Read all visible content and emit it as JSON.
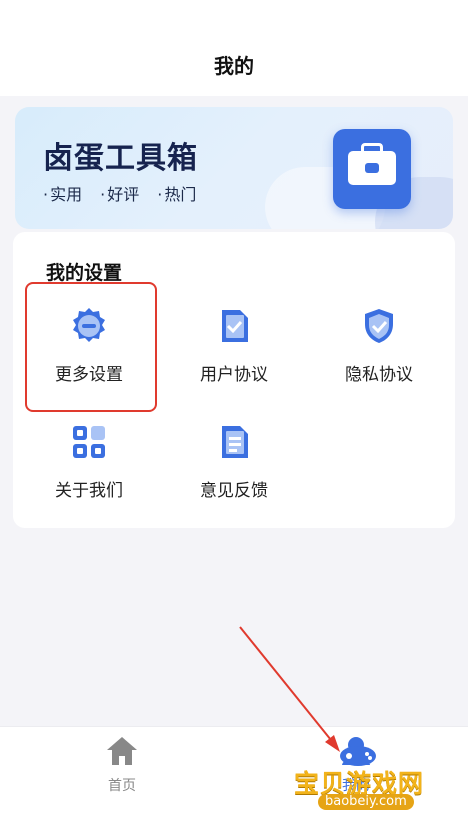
{
  "header": {
    "title": "我的"
  },
  "banner": {
    "title": "卤蛋工具箱",
    "tags": [
      "实用",
      "好评",
      "热门"
    ]
  },
  "settings": {
    "section_title": "我的设置",
    "items": [
      {
        "label": "更多设置",
        "icon": "gear-icon"
      },
      {
        "label": "用户协议",
        "icon": "document-check-icon"
      },
      {
        "label": "隐私协议",
        "icon": "shield-check-icon"
      },
      {
        "label": "关于我们",
        "icon": "grid-apps-icon"
      },
      {
        "label": "意见反馈",
        "icon": "feedback-document-icon"
      }
    ]
  },
  "tabbar": {
    "items": [
      {
        "label": "首页",
        "icon": "home-icon"
      },
      {
        "label": "我的",
        "icon": "profile-icon"
      }
    ]
  },
  "watermark": {
    "text": "宝贝游戏网",
    "url": "baobeiy.com"
  },
  "colors": {
    "accent": "#3b6fe0",
    "icon_light": "#a9c3f5",
    "highlight": "#e03a2e",
    "brand_dark": "#16234f"
  }
}
